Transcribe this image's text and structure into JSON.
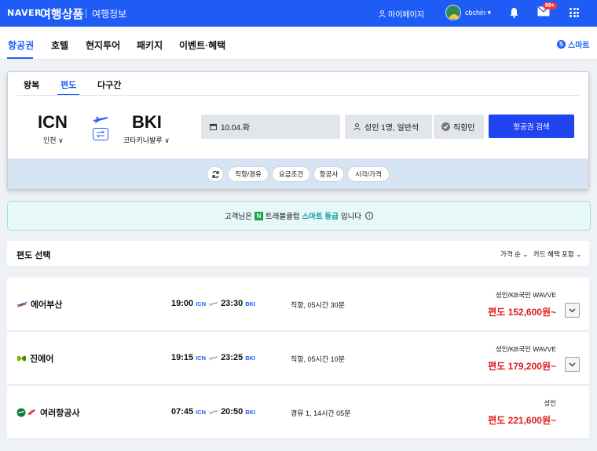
{
  "header": {
    "logo": "NAVER",
    "brand": "여행상품",
    "sub_brand": "여행정보",
    "mypage_label": "마이페이지",
    "username": "cbchin",
    "mail_badge": "99+"
  },
  "nav": {
    "tabs": [
      {
        "label": "항공권",
        "active": true
      },
      {
        "label": "호텔"
      },
      {
        "label": "현지투어"
      },
      {
        "label": "패키지"
      },
      {
        "label": "이벤트·혜택"
      }
    ],
    "smart_label": "스마트"
  },
  "search": {
    "trip_types": [
      "왕복",
      "편도",
      "다구간"
    ],
    "active_trip": "편도",
    "origin": {
      "code": "ICN",
      "city": "인천"
    },
    "destination": {
      "code": "BKI",
      "city": "코타키나발루"
    },
    "date": "10.04.화",
    "passengers": "성인 1명, 일반석",
    "direct_only": "직항만",
    "search_button": "항공권 검색",
    "filters": [
      "직항/경유",
      "요금조건",
      "항공사",
      "시각/가격"
    ]
  },
  "banner": {
    "prefix": "고객님은",
    "club": "트래블클럽",
    "grade": "스마트 등급",
    "suffix": "입니다"
  },
  "results_header": {
    "title": "편도 선택",
    "sort": "가격 순",
    "card": "카드 혜택 포함"
  },
  "results": [
    {
      "airline": "에어부산",
      "dep": "19:00",
      "dep_apt": "ICN",
      "arr": "23:30",
      "arr_apt": "BKI",
      "duration": "직항, 05시간 30분",
      "fare_type": "성인/KB국민 WAVVE",
      "price": "편도 152,600원~",
      "expandable": true
    },
    {
      "airline": "진에어",
      "dep": "19:15",
      "dep_apt": "ICN",
      "arr": "23:25",
      "arr_apt": "BKI",
      "duration": "직항, 05시간 10분",
      "fare_type": "성인/KB국민 WAVVE",
      "price": "편도 179,200원~",
      "expandable": true
    },
    {
      "airline": "여러항공사",
      "dep": "07:45",
      "dep_apt": "ICN",
      "arr": "20:50",
      "arr_apt": "BKI",
      "duration": "경유 1, 14시간 05분",
      "fare_type": "성인",
      "price": "편도 221,600원~",
      "expandable": false
    }
  ],
  "colors": {
    "brand": "#1f5cf6",
    "price": "#e01b1b",
    "teal": "#0d9aa0"
  }
}
